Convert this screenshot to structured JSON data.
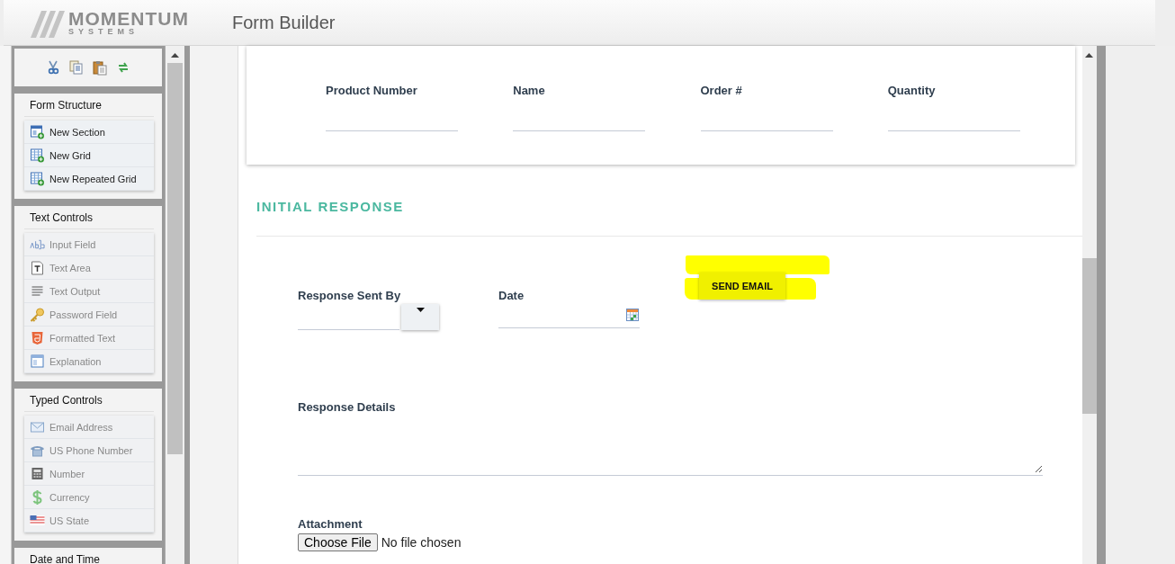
{
  "header": {
    "logo": {
      "line1": "MOMENTUM",
      "line2": "SYSTEMS"
    },
    "title": "Form Builder"
  },
  "sidebar": {
    "panels": [
      {
        "title": "Form Structure",
        "items": [
          {
            "label": "New Section",
            "disabled": false
          },
          {
            "label": "New Grid",
            "disabled": false
          },
          {
            "label": "New Repeated Grid",
            "disabled": false
          }
        ]
      },
      {
        "title": "Text Controls",
        "items": [
          {
            "label": "Input Field",
            "disabled": true
          },
          {
            "label": "Text Area",
            "disabled": true
          },
          {
            "label": "Text Output",
            "disabled": true
          },
          {
            "label": "Password Field",
            "disabled": true
          },
          {
            "label": "Formatted Text",
            "disabled": true
          },
          {
            "label": "Explanation",
            "disabled": true
          }
        ]
      },
      {
        "title": "Typed Controls",
        "items": [
          {
            "label": "Email Address",
            "disabled": true
          },
          {
            "label": "US Phone Number",
            "disabled": true
          },
          {
            "label": "Number",
            "disabled": true
          },
          {
            "label": "Currency",
            "disabled": true
          },
          {
            "label": "US State",
            "disabled": true
          }
        ]
      },
      {
        "title": "Date and Time"
      }
    ]
  },
  "form": {
    "top_grid": {
      "columns": [
        "Product Number",
        "Name",
        "Order #",
        "Quantity"
      ]
    },
    "section": {
      "title": "INITIAL RESPONSE"
    },
    "response_sent_by": {
      "label": "Response Sent By"
    },
    "date": {
      "label": "Date"
    },
    "send_email": {
      "label": "SEND EMAIL",
      "highlighted": true
    },
    "response_details": {
      "label": "Response Details"
    },
    "attachment": {
      "label": "Attachment",
      "button": "Choose File",
      "status": "No file chosen"
    }
  }
}
